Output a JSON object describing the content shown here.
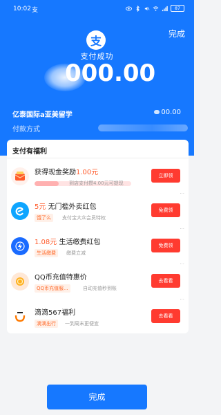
{
  "status_bar": {
    "time": "10:02",
    "app_glyph": "支",
    "battery": "87"
  },
  "header": {
    "done_label": "完成",
    "brand_glyph": "支",
    "status": "支付成功",
    "amount": "000.00"
  },
  "merchant": {
    "name": "亿泰国际a亚美留学",
    "amount": "00.00"
  },
  "payment_method": {
    "label": "付款方式"
  },
  "benefits": {
    "title": "支付有福利",
    "items": [
      {
        "title_prefix": "获得现金奖励",
        "title_highlight": "1.00元",
        "progress_text": "到店支付攒4.00元可提现",
        "progress": 0.25,
        "button": "立即领"
      },
      {
        "title_highlight": "5元",
        "title_rest": "无门槛外卖红包",
        "tag": "饿了么",
        "sub": "支付宝大众会员特权",
        "button": "免费领"
      },
      {
        "title_highlight": "1.08元",
        "title_rest": "生活缴费红包",
        "tag": "生活缴费",
        "sub": "缴费立减",
        "button": "免费领"
      },
      {
        "title_rest": "QQ币充值特惠价",
        "tag": "QQ币充值服...",
        "sub": "自动充值秒到账",
        "button": "去看看"
      },
      {
        "title_rest": "滴滴567福利",
        "tag": "滴滴出行",
        "sub": "一到周末更便宜",
        "button": "去看看"
      }
    ]
  },
  "footer": {
    "done_button": "完成"
  },
  "colors": {
    "primary": "#1678ff",
    "accent_red": "#ff3b30",
    "highlight": "#ff5a2a"
  }
}
